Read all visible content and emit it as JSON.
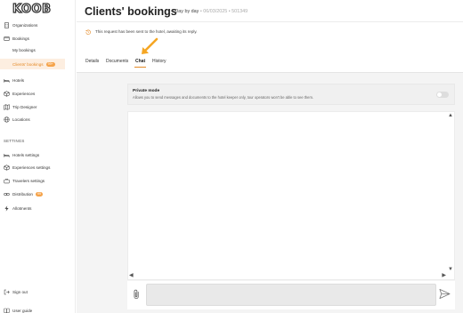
{
  "app": {
    "logo_text": "KOOB"
  },
  "sidebar": {
    "items": [
      {
        "label": "Organizations",
        "icon": "building-icon"
      },
      {
        "label": "Bookings",
        "icon": "folder-icon"
      },
      {
        "label": "My bookings"
      },
      {
        "label": "Clients' bookings",
        "badge": "99+"
      },
      {
        "label": "Hotels",
        "icon": "bed-icon"
      },
      {
        "label": "Experiences",
        "icon": "cube-icon"
      },
      {
        "label": "Trip Designer",
        "icon": "map-icon"
      },
      {
        "label": "Locations",
        "icon": "globe-icon"
      }
    ],
    "settings_label": "SETTINGS",
    "settings_items": [
      {
        "label": "Hotels settings",
        "icon": "bed-icon"
      },
      {
        "label": "Experiences settings",
        "icon": "cube-icon"
      },
      {
        "label": "Travelers settings",
        "icon": "suitcase-icon"
      },
      {
        "label": "Distribution",
        "icon": "link-icon",
        "badge": "99"
      },
      {
        "label": "Allotments",
        "icon": "bolt-icon"
      }
    ],
    "sign_out": "Sign out",
    "user_guide": "User guide"
  },
  "header": {
    "title": "Clients' bookings",
    "meta_type": "• Day by day",
    "meta_date": "• 06/03/2025",
    "meta_id": "• 501349"
  },
  "notice": {
    "text": "This request has been sent to the hotel, awaiting its reply."
  },
  "tabs": [
    {
      "label": "Details"
    },
    {
      "label": "Documents"
    },
    {
      "label": "Chat",
      "active": true
    },
    {
      "label": "History"
    }
  ],
  "private_mode": {
    "title": "Private mode",
    "description": "Allows you to send messages and documents to the hotel keeper only, tour operators won't be able to see them.",
    "enabled": false
  },
  "composer": {
    "value": "",
    "placeholder": ""
  },
  "colors": {
    "accent": "#e48a27",
    "active_bg": "#fdeee0",
    "badge": "#f5a34a",
    "arrow": "#f5a623"
  }
}
